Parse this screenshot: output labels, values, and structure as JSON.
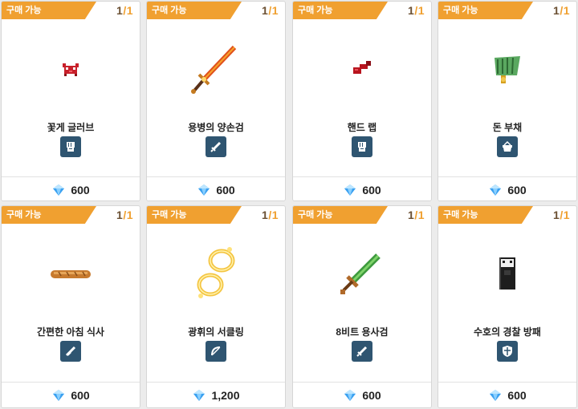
{
  "shop": {
    "items": [
      {
        "badge": "구매 가능",
        "count": "1",
        "max": "1",
        "name": "꽃게 글러브",
        "type_icon": "fist-icon",
        "price": "600",
        "item_icon": "crab-glove-icon"
      },
      {
        "badge": "구매 가능",
        "count": "1",
        "max": "1",
        "name": "용병의 양손검",
        "type_icon": "sword-icon",
        "price": "600",
        "item_icon": "flame-greatsword-icon"
      },
      {
        "badge": "구매 가능",
        "count": "1",
        "max": "1",
        "name": "핸드 랩",
        "type_icon": "fist-icon",
        "price": "600",
        "item_icon": "hand-wrap-icon"
      },
      {
        "badge": "구매 가능",
        "count": "1",
        "max": "1",
        "name": "돈 부채",
        "type_icon": "basket-icon",
        "price": "600",
        "item_icon": "money-fan-icon"
      },
      {
        "badge": "구매 가능",
        "count": "1",
        "max": "1",
        "name": "간편한 아침 식사",
        "type_icon": "gun-icon",
        "price": "600",
        "item_icon": "baguette-icon"
      },
      {
        "badge": "구매 가능",
        "count": "1",
        "max": "1",
        "name": "광휘의 서클링",
        "type_icon": "bow-icon",
        "price": "1,200",
        "item_icon": "radiant-ring-icon"
      },
      {
        "badge": "구매 가능",
        "count": "1",
        "max": "1",
        "name": "8비트 용사검",
        "type_icon": "sword-icon",
        "price": "600",
        "item_icon": "pixel-sword-icon"
      },
      {
        "badge": "구매 가능",
        "count": "1",
        "max": "1",
        "name": "수호의 경찰 방패",
        "type_icon": "shield-icon",
        "price": "600",
        "item_icon": "police-shield-icon"
      }
    ],
    "slash": "/",
    "currency_icon": "diamond-gem-icon",
    "colors": {
      "badge": "#f0a030",
      "type_icon_bg": "#2f5571",
      "gem": "#3aa0f0"
    }
  }
}
